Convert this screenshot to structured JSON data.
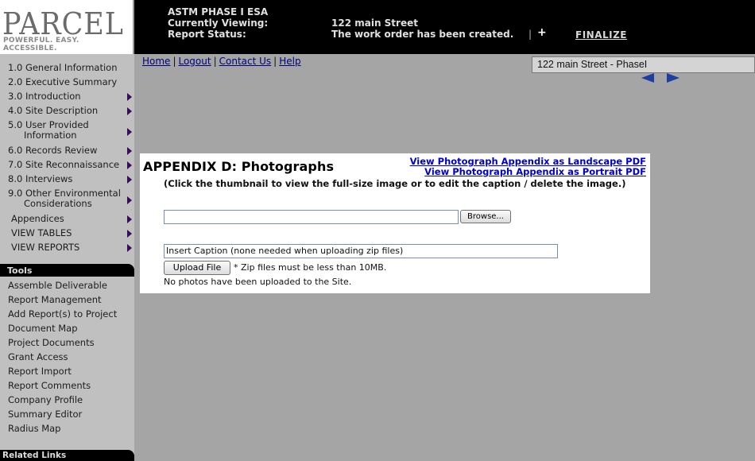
{
  "header": {
    "logo": "PARCEL",
    "tagline": "POWERFUL. EASY. ACCESSIBLE.",
    "report_title": "ASTM PHASE I ESA",
    "currently_viewing_label": "Currently Viewing:",
    "currently_viewing_value": "122 main Street",
    "report_status_label": "Report Status:",
    "report_status_value": "The work order has been created.",
    "separator": "|",
    "plus_icon": "+",
    "finalize_label": "FINALIZE"
  },
  "sidebar": {
    "items": [
      {
        "label": "1.0 General Information",
        "arrow": false
      },
      {
        "label": "2.0 Executive Summary",
        "arrow": false
      },
      {
        "label": "3.0 Introduction",
        "arrow": true
      },
      {
        "label": "4.0 Site Description",
        "arrow": true
      },
      {
        "label": "5.0 User Provided",
        "label2": "Information",
        "arrow": true
      },
      {
        "label": "6.0 Records Review",
        "arrow": true
      },
      {
        "label": "7.0 Site Reconnaissance",
        "arrow": true
      },
      {
        "label": "8.0 Interviews",
        "arrow": true
      },
      {
        "label": "9.0 Other Environmental",
        "label2": "Considerations",
        "arrow": true
      },
      {
        "label": "Appendices",
        "arrow": true
      },
      {
        "label": "VIEW TABLES",
        "arrow": true
      },
      {
        "label": "VIEW REPORTS",
        "arrow": true
      }
    ],
    "tools_heading": "Tools",
    "tools": [
      "Assemble Deliverable",
      "Report Management",
      "Add Report(s) to Project",
      "Document Map",
      "Project Documents",
      "Grant Access",
      "Report Import",
      "Report Comments",
      "Company Profile",
      "Summary Editor",
      "Radius Map"
    ],
    "related_heading": "Related Links"
  },
  "toplinks": {
    "home": "Home",
    "logout": "Logout",
    "contact": "Contact Us",
    "help": "Help",
    "pipe": "|"
  },
  "site_select": {
    "value": "122 main Street - PhaseI"
  },
  "panel": {
    "title": "APPENDIX D: Photographs",
    "landscape_link": "View Photograph Appendix as Landscape PDF",
    "portrait_link": "View Photograph Appendix as Portrait PDF",
    "instructions": "(Click the thumbnail to view the full-size image or to edit the caption / delete the image.)",
    "file_value": "",
    "browse_label": "Browse...",
    "caption_value": "Insert Caption (none needed when uploading zip files)",
    "upload_label": "Upload File",
    "zip_note": "* Zip files must be less than 10MB.",
    "no_photos": "No photos have been uploaded to the Site."
  },
  "icons": {
    "submenu_arrow": "right-triangle-icon",
    "prev": "arrow-left-icon",
    "next": "arrow-right-icon"
  },
  "colors": {
    "header_bg": "#000000",
    "page_bg": "#a5a5a5",
    "sidebar_bg": "#c0c0c0",
    "link": "#0000cc",
    "nav_arrow": "#1c3ea0"
  }
}
